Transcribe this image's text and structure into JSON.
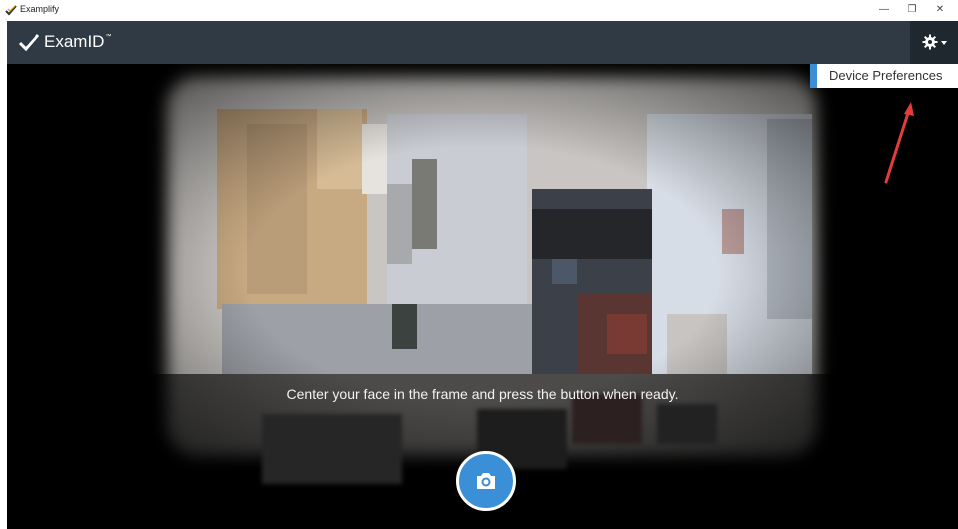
{
  "window": {
    "title": "Examplify",
    "controls": {
      "minimize": "—",
      "restore": "❐",
      "close": "✕"
    }
  },
  "header": {
    "brand": "ExamID",
    "trademark": "™",
    "settings_icon": "gear-icon",
    "background": "#2f3a44"
  },
  "settings_menu": {
    "items": [
      "Device Preferences"
    ],
    "accent": "#3b8fd6"
  },
  "camera": {
    "instruction": "Center your face in the frame and press the button when ready.",
    "capture_icon": "camera-icon",
    "button_color": "#3b8fd6"
  }
}
